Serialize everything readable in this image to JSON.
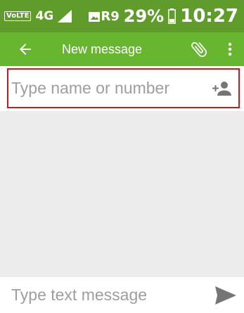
{
  "status_bar": {
    "volte_label": "VoLTE",
    "network_type": "4G",
    "carrier": "R9",
    "battery_percent": "29%",
    "time": "10:27",
    "icons": [
      "signal-icon",
      "image-notification-icon",
      "battery-icon"
    ]
  },
  "app_bar": {
    "title": "New message",
    "icons": [
      "back-arrow-icon",
      "paperclip-icon",
      "more-vert-icon"
    ]
  },
  "recipient": {
    "placeholder": "Type name or number",
    "value": "",
    "icon": "add-contact-icon"
  },
  "compose": {
    "placeholder": "Type text message",
    "value": "",
    "icon": "send-icon"
  },
  "colors": {
    "status_bar_bg": "#5f9c2c",
    "app_bar_bg": "#68b62f",
    "highlight_border": "#d2151f",
    "conversation_bg": "#ececec",
    "icon_gray": "#757575"
  }
}
